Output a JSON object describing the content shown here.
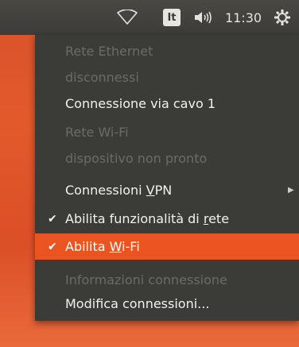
{
  "topbar": {
    "keyboard_indicator": "It",
    "clock": "11:30",
    "icons": [
      "wifi-icon",
      "volume-icon",
      "gear-icon"
    ]
  },
  "menu": {
    "ethernet_header": "Rete Ethernet",
    "ethernet_status": "disconnessi",
    "wired_connection": "Connessione via cavo 1",
    "wifi_header": "Rete Wi-Fi",
    "wifi_status": "dispositivo non pronto",
    "vpn": {
      "pre": "Connessioni ",
      "mnemonic": "V",
      "post": "PN"
    },
    "enable_networking": {
      "pre": "Abilita funzionalità di ",
      "mnemonic": "r",
      "post": "ete",
      "checked": true
    },
    "enable_wifi": {
      "pre": "Abilita ",
      "mnemonic": "W",
      "post": "i-Fi",
      "checked": true
    },
    "connection_info": "Informazioni connessione",
    "edit_connections": "Modifica connessioni...",
    "check_glyph": "✔",
    "submenu_arrow": "▶"
  },
  "colors": {
    "accent": "#e95420",
    "panel": "#3b3b37",
    "disabled_text": "#6c6b66"
  }
}
